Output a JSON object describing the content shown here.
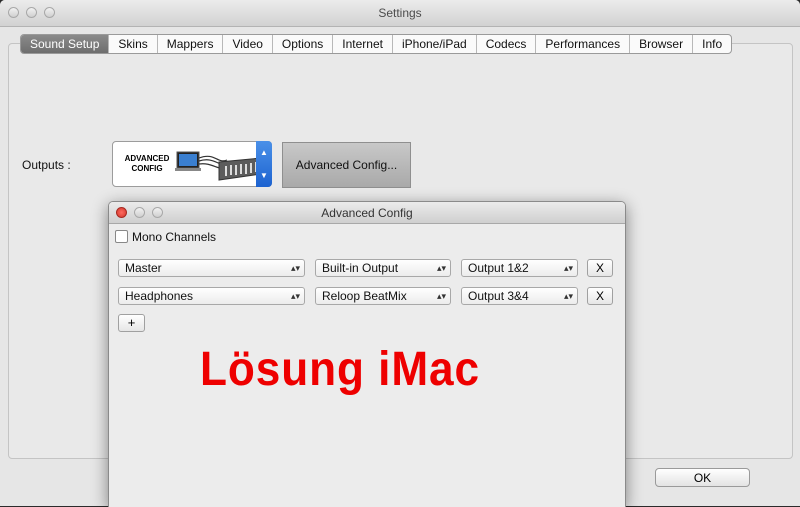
{
  "window": {
    "title": "Settings"
  },
  "tabs": [
    {
      "label": "Sound Setup",
      "active": true
    },
    {
      "label": "Skins"
    },
    {
      "label": "Mappers"
    },
    {
      "label": "Video"
    },
    {
      "label": "Options"
    },
    {
      "label": "Internet"
    },
    {
      "label": "iPhone/iPad"
    },
    {
      "label": "Codecs"
    },
    {
      "label": "Performances"
    },
    {
      "label": "Browser"
    },
    {
      "label": "Info"
    }
  ],
  "outputs": {
    "label": "Outputs :",
    "selected_image_text": "ADVANCED\nCONFIG",
    "config_button": "Advanced Config..."
  },
  "ok_button": "OK",
  "dialog": {
    "title": "Advanced Config",
    "mono_label": "Mono Channels",
    "mono_checked": false,
    "rows": [
      {
        "channel": "Master",
        "device": "Built-in Output",
        "output": "Output 1&2",
        "remove": "X"
      },
      {
        "channel": "Headphones",
        "device": "Reloop BeatMix",
        "output": "Output 3&4",
        "remove": "X"
      }
    ],
    "add_button": "+"
  },
  "overlay_text": "Lösung iMac",
  "colors": {
    "overlay": "#ee0000",
    "active_tab": "#7a7a7a",
    "stepper_blue": "#2a6fd8"
  }
}
